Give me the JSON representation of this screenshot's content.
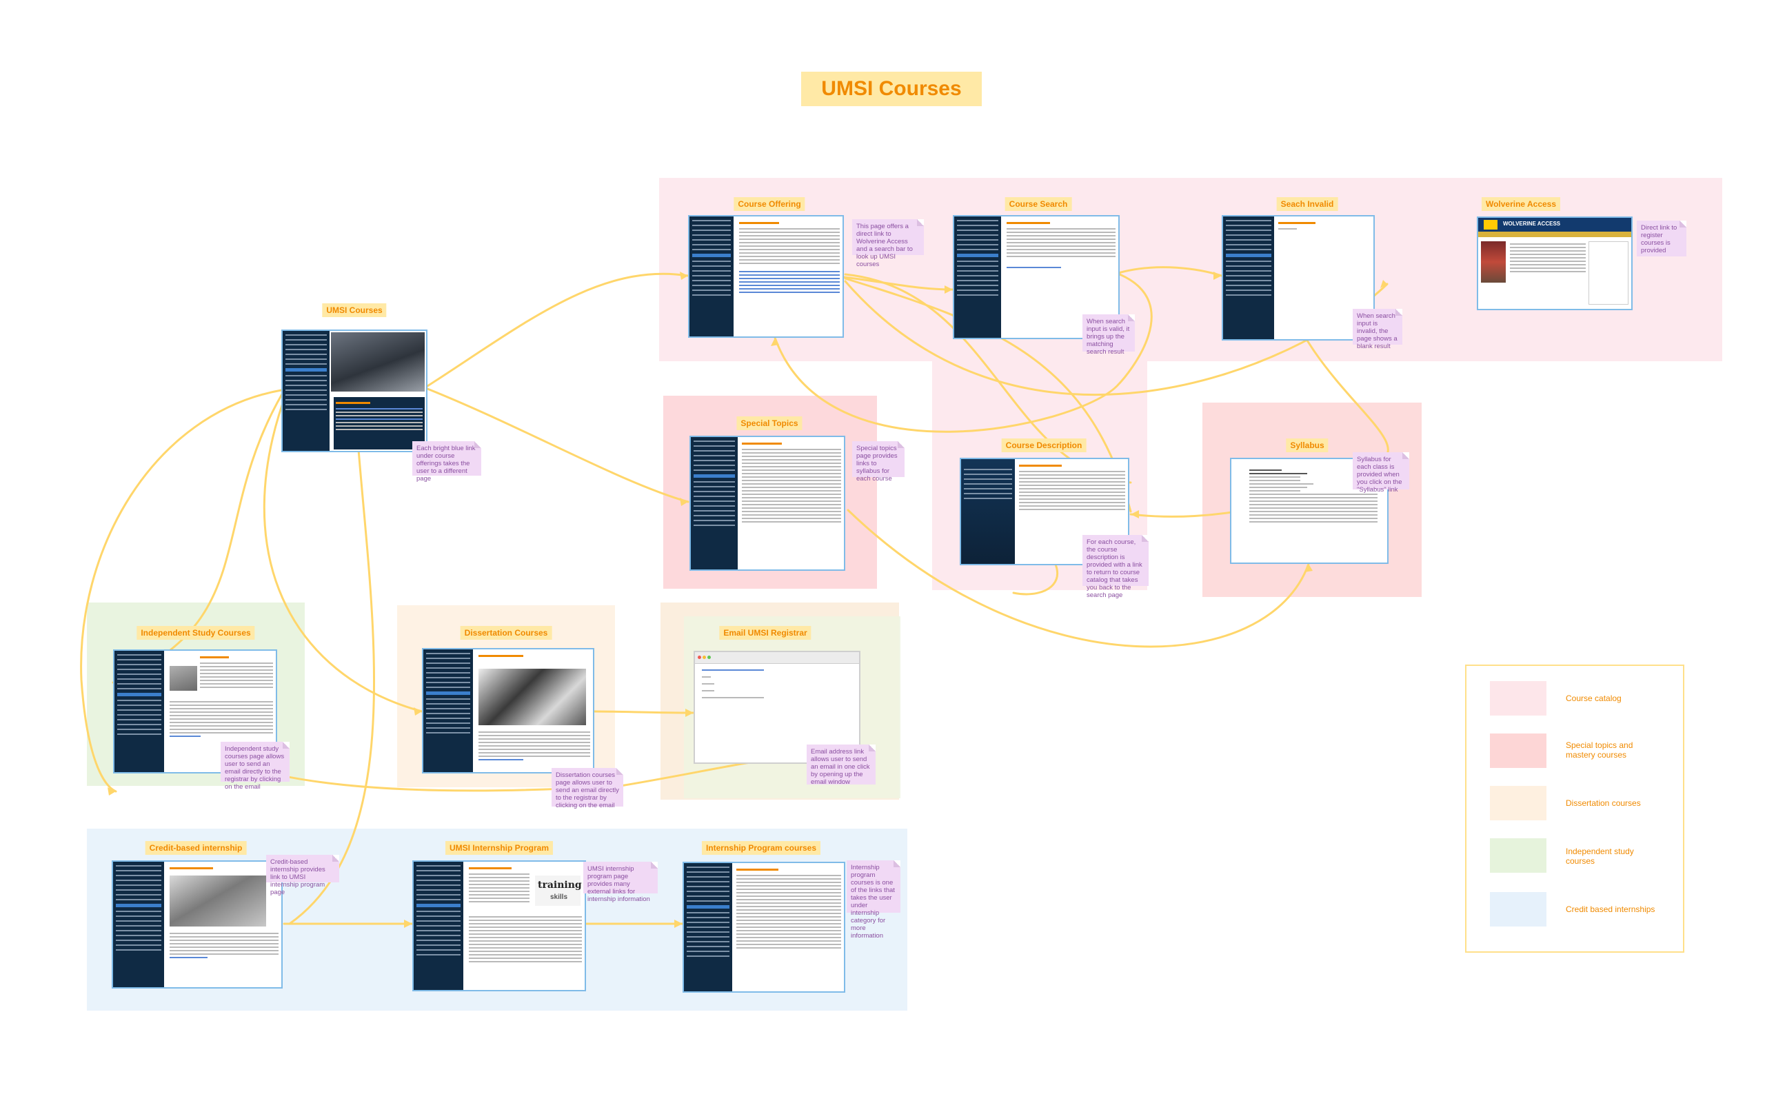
{
  "title": "UMSI Courses",
  "pages": {
    "umsi_courses": "UMSI Courses",
    "course_offering": "Course Offering",
    "course_search": "Course Search",
    "search_invalid": "Seach Invalid",
    "wolverine_access": "Wolverine Access",
    "special_topics": "Special Topics",
    "course_description": "Course Description",
    "syllabus": "Syllabus",
    "independent_study": "Independent Study Courses",
    "dissertation": "Dissertation Courses",
    "email_registrar": "Email UMSI Registrar",
    "credit_internship": "Credit-based internship",
    "umsi_internship": "UMSI Internship Program",
    "internship_courses": "Internship Program courses"
  },
  "notes": {
    "umsi_courses": "Each bright blue link under course offerings takes the user to a different page",
    "course_offering": "This page offers a direct link to Wolverine Access and a search bar to look up UMSI courses",
    "course_search": "When search input is valid, it brings up the matching search result",
    "search_invalid": "When search input is invalid, the page shows a blank result",
    "wolverine_access": "Direct link to register courses is provided",
    "special_topics": "Special topics page provides links to syllabus for each course",
    "course_description": "For each course, the course description is provided with a link to return to course catalog that takes you back to the search page",
    "syllabus": "Syllabus for each class is provided when you click on the \"Syllabus\" link",
    "independent_study": "Independent study courses page allows user to send an email directly to the registrar by clicking on the email",
    "dissertation": "Dissertation courses page allows user to send an email directly to the registrar by clicking on the email",
    "email_registrar": "Email address link allows user to send an email in one click by opening up the email window",
    "credit_internship": "Credit-based internship provides link to UMSI internship program page",
    "umsi_internship": "UMSI internship program page provides many external links for internship information",
    "internship_courses": "Internship program courses is one of the links that takes the user under internship category for more information"
  },
  "screens": {
    "wolverine_header": "WOLVERINE ACCESS",
    "training_word": "training",
    "skills_word": "skills"
  },
  "legend": [
    {
      "label": "Course catalog",
      "color": "#fde6ea"
    },
    {
      "label": "Special topics and mastery courses",
      "color": "#fdd6d6"
    },
    {
      "label": "Dissertation courses",
      "color": "#fef0e0"
    },
    {
      "label": "Independent study courses",
      "color": "#e6f3dc"
    },
    {
      "label": "Credit based internships",
      "color": "#e6f1fb"
    }
  ]
}
